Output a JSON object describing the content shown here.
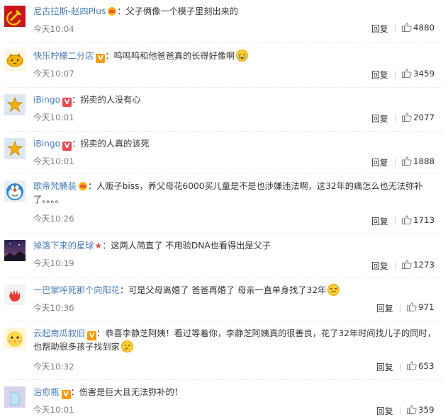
{
  "comments": [
    {
      "username": "尼古拉斯-赵四Plus",
      "badge": "crown",
      "separator": "：",
      "text": "父子俩像一个模子里刻出来的",
      "emoji": "",
      "time": "今天10:04",
      "reply_label": "回复",
      "likes": "4880",
      "avatar": "hammer-sickle"
    },
    {
      "username": "快乐柠檬二分店",
      "badge": "orange-v",
      "separator": "：",
      "text": "呜呜呜和他爸爸真的长得好像啊",
      "emoji": "crying-face",
      "time": "今天10:07",
      "reply_label": "回复",
      "likes": "3459",
      "avatar": "lemon-cat"
    },
    {
      "username": "iBingo",
      "badge": "red-v",
      "separator": "：",
      "text": "拐卖的人没有心",
      "emoji": "",
      "time": "今天10:01",
      "reply_label": "回复",
      "likes": "2077",
      "avatar": "star"
    },
    {
      "username": "iBingo",
      "badge": "red-v",
      "separator": "：",
      "text": "拐卖的人真的该死",
      "emoji": "",
      "time": "今天10:01",
      "reply_label": "回复",
      "likes": "1888",
      "avatar": "star"
    },
    {
      "username": "歌帝梵桶装",
      "badge": "crown",
      "separator": "：",
      "text": "人贩子biss，养父母花6000买儿童是不是也涉嫌违法啊，这32年的痛怎么也无法弥补了。。。。",
      "emoji": "",
      "time": "今天10:26",
      "reply_label": "回复",
      "likes": "1713",
      "avatar": "doraemon"
    },
    {
      "username": "掉落下来的星球",
      "badge": "red-star",
      "separator": "：",
      "text": "这两人简直了 不用验DNA也看得出是父子",
      "emoji": "",
      "time": "今天10:19",
      "reply_label": "回复",
      "likes": "1273",
      "avatar": "night-sky"
    },
    {
      "username": "一巴掌呼死那个向阳花",
      "badge": "",
      "separator": "：",
      "text": "可是父母离婚了 爸爸再婚了 母亲一直单身找了32年",
      "emoji": "sweat-face",
      "time": "今天10:36",
      "reply_label": "回复",
      "likes": "971",
      "avatar": "red-hand"
    },
    {
      "username": "云起南瓜叙旧",
      "badge": "orange-v",
      "separator": "：",
      "text": "恭喜李静芝阿姨！看过等着你，李静芝阿姨真的很善良，花了32年时间找儿子的同时，也帮助很多孩子找到家",
      "emoji": "thinking-face",
      "time": "今天10:32",
      "reply_label": "回复",
      "likes": "653",
      "avatar": "yellow-chick"
    },
    {
      "username": "治愈瓶",
      "badge": "orange-v",
      "separator": "：",
      "text": "伤害是巨大且无法弥补的！",
      "emoji": "",
      "time": "今天10:01",
      "reply_label": "回复",
      "likes": "359",
      "avatar": "bottle"
    }
  ],
  "colors": {
    "username": "#4a7cb7",
    "text": "#333333",
    "time": "#808080",
    "v_orange": "#ff9900",
    "v_red": "#e8484e"
  },
  "icons": {
    "like": "thumb-up-icon"
  }
}
